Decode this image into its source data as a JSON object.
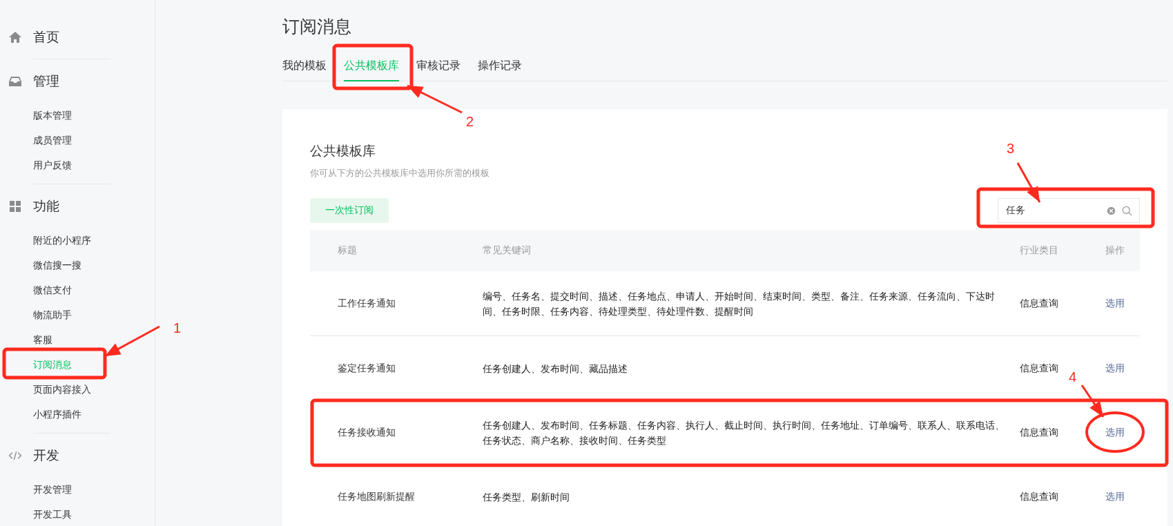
{
  "sidebar": {
    "sections": [
      {
        "label": "首页"
      },
      {
        "label": "管理",
        "items": [
          {
            "label": "版本管理",
            "selected": false
          },
          {
            "label": "成员管理",
            "selected": false
          },
          {
            "label": "用户反馈",
            "selected": false
          }
        ]
      },
      {
        "label": "功能",
        "items": [
          {
            "label": "附近的小程序",
            "selected": false
          },
          {
            "label": "微信搜一搜",
            "selected": false
          },
          {
            "label": "微信支付",
            "selected": false
          },
          {
            "label": "物流助手",
            "selected": false
          },
          {
            "label": "客服",
            "selected": false
          },
          {
            "label": "订阅消息",
            "selected": true
          },
          {
            "label": "页面内容接入",
            "selected": false
          },
          {
            "label": "小程序插件",
            "selected": false
          }
        ]
      },
      {
        "label": "开发",
        "items": [
          {
            "label": "开发管理",
            "selected": false
          },
          {
            "label": "开发工具",
            "selected": false
          }
        ]
      }
    ]
  },
  "page": {
    "title": "订阅消息"
  },
  "tabs": [
    {
      "label": "我的模板",
      "selected": false
    },
    {
      "label": "公共模板库",
      "selected": true
    },
    {
      "label": "审核记录",
      "selected": false
    },
    {
      "label": "操作记录",
      "selected": false
    }
  ],
  "card": {
    "title": "公共模板库",
    "subtitle": "你可从下方的公共模板库中选用你所需的模板",
    "button": "一次性订阅",
    "search": {
      "value": "任务"
    }
  },
  "table": {
    "columns": [
      "标题",
      "常见关键词",
      "行业类目",
      "操作"
    ],
    "rows": [
      {
        "title": "工作任务通知",
        "keywords": "编号、任务名、提交时间、描述、任务地点、申请人、开始时间、结束时间、类型、备注、任务来源、任务流向、下达时间、任务时限、任务内容、待处理类型、待处理件数、提醒时间",
        "category": "信息查询",
        "action": "选用"
      },
      {
        "title": "鉴定任务通知",
        "keywords": "任务创建人、发布时间、藏品描述",
        "category": "信息查询",
        "action": "选用"
      },
      {
        "title": "任务接收通知",
        "keywords": "任务创建人、发布时间、任务标题、任务内容、执行人、截止时间、执行时间、任务地址、订单编号、联系人、联系电话、任务状态、商户名称、接收时间、任务类型",
        "category": "信息查询",
        "action": "选用"
      },
      {
        "title": "任务地图刷新提醒",
        "keywords": "任务类型、刷新时间",
        "category": "信息查询",
        "action": "选用"
      }
    ]
  },
  "annotations": [
    {
      "label": "1"
    },
    {
      "label": "2"
    },
    {
      "label": "3"
    },
    {
      "label": "4"
    }
  ]
}
